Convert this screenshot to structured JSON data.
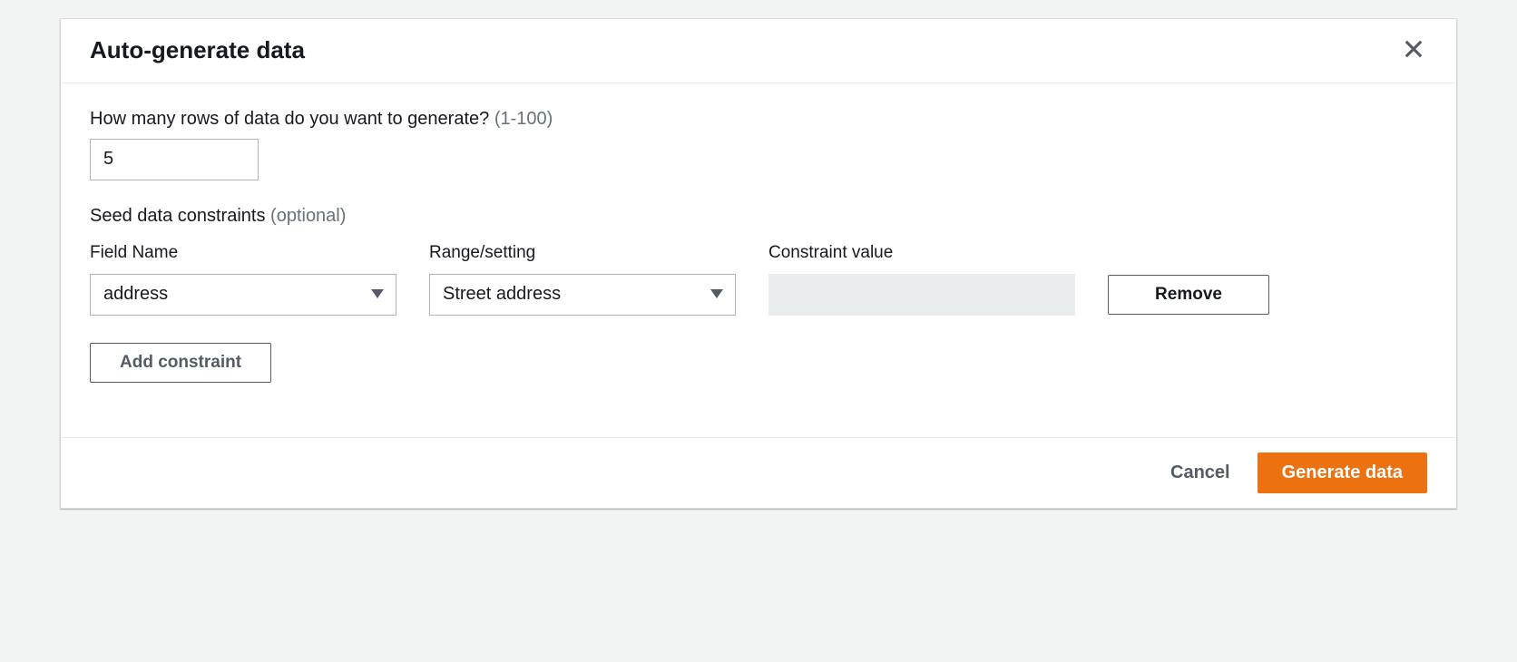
{
  "modal": {
    "title": "Auto-generate data",
    "rows_label": "How many rows of data do you want to generate?",
    "rows_hint": "(1-100)",
    "rows_value": "5",
    "seed_label": "Seed data constraints",
    "seed_hint": "(optional)",
    "columns": {
      "field": "Field Name",
      "range": "Range/setting",
      "value": "Constraint value"
    },
    "constraint": {
      "field": "address",
      "range": "Street address",
      "value": "",
      "remove_label": "Remove"
    },
    "add_label": "Add constraint",
    "cancel_label": "Cancel",
    "generate_label": "Generate data"
  }
}
